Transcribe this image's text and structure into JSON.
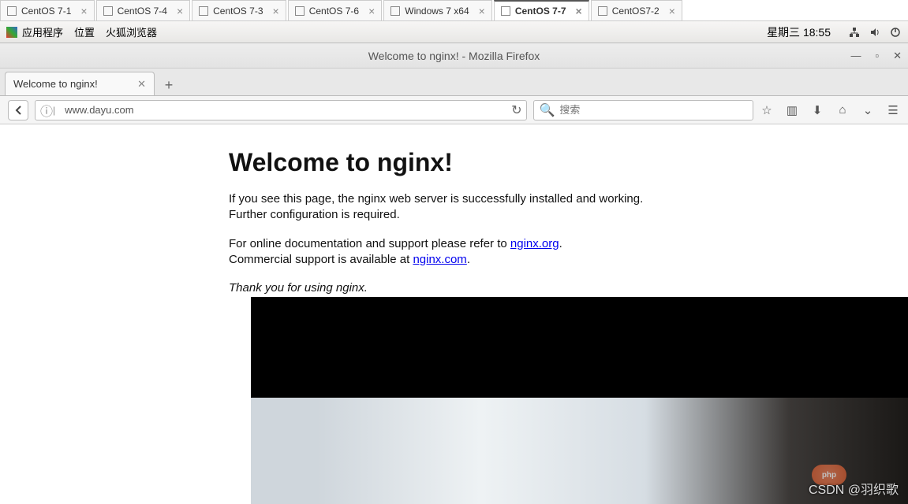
{
  "vm_tabs": [
    {
      "label": "CentOS 7-1",
      "active": false
    },
    {
      "label": "CentOS 7-4",
      "active": false
    },
    {
      "label": "CentOS 7-3",
      "active": false
    },
    {
      "label": "CentOS 7-6",
      "active": false
    },
    {
      "label": "Windows 7 x64",
      "active": false
    },
    {
      "label": "CentOS 7-7",
      "active": true
    },
    {
      "label": "CentOS7-2",
      "active": false
    }
  ],
  "gnome": {
    "apps": "应用程序",
    "places": "位置",
    "firefox": "火狐浏览器",
    "clock": "星期三 18:55"
  },
  "firefox": {
    "window_title": "Welcome to nginx! - Mozilla Firefox",
    "tab_title": "Welcome to nginx!",
    "url": "www.dayu.com",
    "search_placeholder": "搜索"
  },
  "page": {
    "heading": "Welcome to nginx!",
    "p1a": "If you see this page, the nginx web server is successfully installed and working.",
    "p1b": "Further configuration is required.",
    "p2a": "For online documentation and support please refer to ",
    "link1": "nginx.org",
    "p2b": "Commercial support is available at ",
    "link2": "nginx.com",
    "thanks": "Thank you for using nginx."
  },
  "watermark": {
    "text": "CSDN @羽织歌",
    "badge": "php"
  }
}
